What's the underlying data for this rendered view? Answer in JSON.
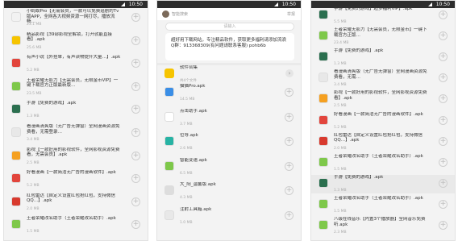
{
  "status_time": "10:50",
  "colors": {
    "green": "#7ec84a",
    "orange": "#f5a020",
    "blue": "#3a8ee6",
    "yellow": "#f6c400",
    "red": "#e2453c"
  },
  "left": {
    "rows": [
      {
        "title": "小蚂蚁Pro【无需会员，一款可以免费追剧的Tv版APP，全网各大视频资源一网打尽，播放流畅…",
        "size": "23.1 MB",
        "icon": "mouse-icon",
        "color": "#f2f2f2"
      },
      {
        "title": "精品影视【39部影视全解锁，打开就能直接看】.apk",
        "size": "25.6 MB",
        "icon": "cloud-icon",
        "color": "#f6c400"
      },
      {
        "title": "有声小说【外挂单，有声读物提升大量…】.apk",
        "size": "5.2 MB",
        "icon": "mic-icon",
        "color": "#e2453c"
      },
      {
        "title": "王者荣耀无影力【无需会员，无限金币VIP】一键下载官方正版最新版…",
        "size": "23.5 MB",
        "icon": "android-icon",
        "color": "#7ec84a"
      },
      {
        "title": "手游【免费的游戏】.apk",
        "size": "1.3 MB",
        "icon": "app-icon",
        "color": "#2b6f4f"
      },
      {
        "title": "看漫画清爽版（无广告无弹窗）全网漫画资源免费看，无需登录…",
        "size": "3.4 MB",
        "icon": "doc-icon",
        "color": "#e8e8e8"
      },
      {
        "title": "影视【一款好用的影视软件，全网影视资源免费看，无需会员】.apk",
        "size": "2.5 MB",
        "icon": "film-icon",
        "color": "#f5a020"
      },
      {
        "title": "好看漫画【一款简洁无广告的漫画软件】.apk",
        "size": "5.2 MB",
        "icon": "manga-icon",
        "color": "#e2453c"
      },
      {
        "title": "红包雷达【自定义设置红包抢红包，支持微信QQ…】.apk",
        "size": "2.0 MB",
        "icon": "scissors-icon",
        "color": "#d83a2e"
      },
      {
        "title": "王者荣耀改名助手（王者荣耀改名助手）.apk",
        "size": "1.5 MB",
        "icon": "android-icon",
        "color": "#7ec84a"
      }
    ]
  },
  "middle": {
    "header_hint": "智能搜索",
    "header_link": "举报",
    "search_placeholder": "请输入",
    "notice": "超好用下载网站，专注精品软件，获取更多福利请添加流浪Q群：913368309(有问题请联系客服) pohb6b",
    "folder": {
      "title": "软件合集",
      "size": "共4个文件"
    },
    "rows": [
      {
        "title": "猫猫Pro.apk",
        "size": "14.5 MB",
        "icon": "android-icon",
        "color": "#3a8ee6"
      },
      {
        "title": "点击助手.apk",
        "size": "3.7 MB",
        "icon": "c-icon",
        "color": "#ffffff"
      },
      {
        "title": "位导.apk",
        "size": "2.6 MB",
        "icon": "pin-icon",
        "color": "#27b3a4"
      },
      {
        "title": "智能变速.apk",
        "size": "6.5 MB",
        "icon": "android-icon",
        "color": "#7ec84a"
      },
      {
        "title": "大_阳_温馨版.apk",
        "size": "4.3 MB",
        "icon": "sun-icon",
        "color": "#dddddd"
      },
      {
        "title": "注射工具箱.apk",
        "size": "1.0 MB",
        "icon": "bars-icon",
        "color": "#e8e8e8"
      }
    ]
  },
  "right": {
    "rows": [
      {
        "title": "手游【免费的游戏】超多福利VIP】.apk",
        "size": "5.5 MB",
        "icon": "app-icon",
        "color": "#2b6f4f"
      },
      {
        "title": "王者荣耀无影力【无需会员，无限金币】一键下载官方正版…",
        "size": "23.4 MB",
        "icon": "android-icon",
        "color": "#7ec84a"
      },
      {
        "title": "手游【免费的游戏】.apk",
        "size": "1.3 MB",
        "icon": "app-icon",
        "color": "#2b6f4f"
      },
      {
        "title": "看漫画清爽版（无广告无弹窗）全网漫画资源免费看，无需…",
        "size": "3.4 MB",
        "icon": "doc-icon",
        "color": "#e8e8e8"
      },
      {
        "title": "影视【一款好用的影视软件，全网影视资源免费看】.apk",
        "size": "2.5 MB",
        "icon": "film-icon",
        "color": "#f5a020"
      },
      {
        "title": "好看漫画【一款简洁无广告的漫画软件】.apk",
        "size": "5.2 MB",
        "icon": "manga-icon",
        "color": "#e2453c"
      },
      {
        "title": "红包雷达【自定义设置红包抢红包，支持微信QQ…】.apk",
        "size": "2.0 MB",
        "icon": "scissors-icon",
        "color": "#d83a2e"
      },
      {
        "title": "王者荣耀改名助手（王者荣耀改名助手）.apk",
        "size": "1.5 MB",
        "icon": "android-icon",
        "color": "#7ec84a"
      },
      {
        "title": "手游【免费的游戏】.apk",
        "size": "1.3 MB",
        "icon": "app-icon",
        "color": "#2b6f4f"
      },
      {
        "title": "王者荣耀改名助手（王者荣耀改名助手）.apk",
        "size": "1.5 MB",
        "icon": "android-icon",
        "color": "#7ec84a"
      },
      {
        "title": "八级在线音乐【内置3个播放器】全网音乐免费听.apk",
        "size": "2.3 MB",
        "icon": "android-icon",
        "color": "#7ec84a"
      }
    ]
  }
}
